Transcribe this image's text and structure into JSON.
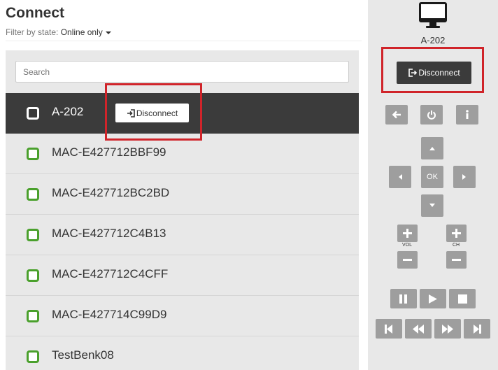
{
  "header": {
    "title": "Connect",
    "filter_label": "Filter by state:",
    "filter_value": "Online only"
  },
  "search": {
    "placeholder": "Search"
  },
  "devices": [
    {
      "name": "A-202",
      "selected": true,
      "action_label": "Disconnect"
    },
    {
      "name": "MAC-E427712BBF99"
    },
    {
      "name": "MAC-E427712BC2BD"
    },
    {
      "name": "MAC-E427712C4B13"
    },
    {
      "name": "MAC-E427712C4CFF"
    },
    {
      "name": "MAC-E427714C99D9"
    },
    {
      "name": "TestBenk08"
    }
  ],
  "remote": {
    "device_name": "A-202",
    "disconnect_label": "Disconnect",
    "ok_label": "OK",
    "vol_label": "VOL",
    "ch_label": "CH",
    "icons": [
      "monitor-icon",
      "back-icon",
      "power-icon",
      "info-icon",
      "up-icon",
      "left-icon",
      "right-icon",
      "down-icon",
      "plus-icon",
      "minus-icon",
      "pause-icon",
      "play-icon",
      "stop-icon",
      "skip-start-icon",
      "rewind-icon",
      "fast-forward-icon",
      "skip-end-icon"
    ]
  },
  "colors": {
    "online": "#4aa02c",
    "selected_row": "#3b3b3b",
    "highlight": "#d0242a",
    "remote_button": "#9e9e9e"
  }
}
